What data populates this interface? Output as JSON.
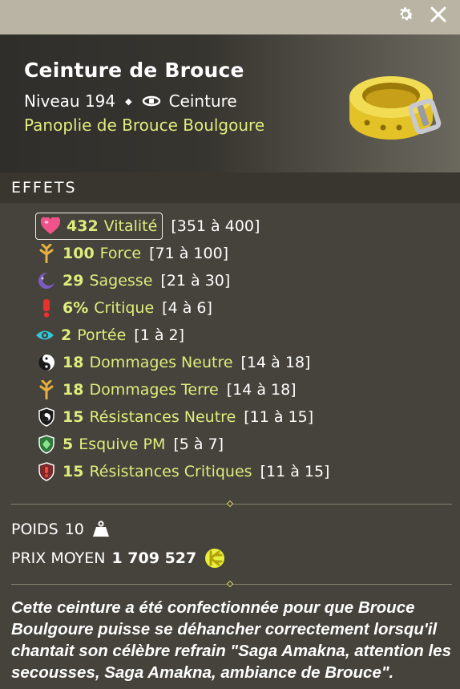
{
  "window": {
    "settings_icon": "gear-icon",
    "close_icon": "close-icon"
  },
  "item": {
    "name": "Ceinture de Brouce",
    "level_label": "Niveau 194",
    "type_label": "Ceinture",
    "set_name": "Panoplie de Brouce Boulgoure"
  },
  "effects_header": "EFFETS",
  "effects": [
    {
      "icon": "heart-icon",
      "value": "432",
      "name": "Vitalité",
      "range": "[351 à 400]"
    },
    {
      "icon": "strength-icon",
      "value": "100",
      "name": "Force",
      "range": "[71 à 100]"
    },
    {
      "icon": "wisdom-icon",
      "value": "29",
      "name": "Sagesse",
      "range": "[21 à 30]"
    },
    {
      "icon": "critical-icon",
      "value": "6%",
      "name": "Critique",
      "range": "[4 à 6]"
    },
    {
      "icon": "eye-icon",
      "value": "2",
      "name": "Portée",
      "range": "[1 à 2]"
    },
    {
      "icon": "yin-yang-icon",
      "value": "18",
      "name": "Dommages Neutre",
      "range": "[14 à 18]"
    },
    {
      "icon": "earth-icon",
      "value": "18",
      "name": "Dommages Terre",
      "range": "[14 à 18]"
    },
    {
      "icon": "neutral-shield-icon",
      "value": "15",
      "name": "Résistances Neutre",
      "range": "[11 à 15]"
    },
    {
      "icon": "green-shield-icon",
      "value": "5",
      "name": "Esquive PM",
      "range": "[5 à 7]"
    },
    {
      "icon": "critical-shield-icon",
      "value": "15",
      "name": "Résistances Critiques",
      "range": "[11 à 15]"
    }
  ],
  "weight": {
    "label": "POIDS",
    "value": "10",
    "icon": "weight-icon"
  },
  "price": {
    "label": "PRIX MOYEN",
    "value": "1 709 527",
    "icon": "kamas-icon"
  },
  "description": "Cette ceinture a été confectionnée pour que Brouce Boulgoure puisse se déhancher correctement lorsqu'il chantait son célèbre refrain \"Saga Amakna, attention les secousses, Saga Amakna, ambiance de Brouce\".",
  "colors": {
    "accent_yellow": "#dfec7d",
    "panel_bg": "#45433b",
    "topbar_bg": "#b9b4a3",
    "section_bg": "#38362f"
  }
}
